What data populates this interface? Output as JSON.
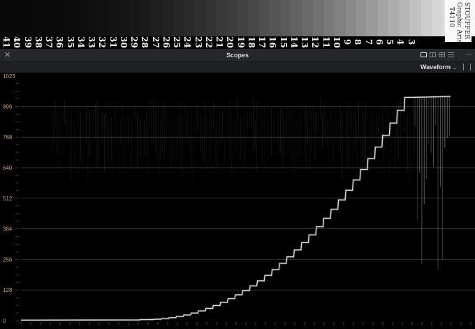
{
  "wedge": {
    "step_numbers": [
      "41",
      "40",
      "39",
      "38",
      "37",
      "36",
      "35",
      "34",
      "33",
      "32",
      "31",
      "30",
      "29",
      "28",
      "27",
      "26",
      "25",
      "24",
      "23",
      "22",
      "21",
      "20",
      "19",
      "18",
      "17",
      "16",
      "15",
      "14",
      "13",
      "12",
      "11",
      "10",
      "9",
      "8",
      "7",
      "6",
      "5",
      "4",
      "3"
    ],
    "label_lines": [
      "STOUFFER",
      "Graphic Arts",
      "T4110"
    ]
  },
  "titlebar": {
    "close_icon": "close-icon",
    "title": "Scopes",
    "layout_icons": [
      "single-layout-icon",
      "dual-layout-icon",
      "quad-layout-icon",
      "list-layout-icon"
    ],
    "more_icon": "more-icon",
    "more_label": "···"
  },
  "scopebar": {
    "scope_type": "Waveform",
    "dropdown_icon": "chevron-down-icon",
    "settings_icon": "settings-icon"
  },
  "waveform": {
    "y_ticks": [
      "1023",
      "896",
      "768",
      "640",
      "512",
      "384",
      "256",
      "128",
      "0"
    ],
    "y_range": [
      0,
      1023
    ],
    "colors": {
      "grid": "#6b5a3a",
      "label": "#c8a36a",
      "trace": "#ffffff"
    }
  }
}
